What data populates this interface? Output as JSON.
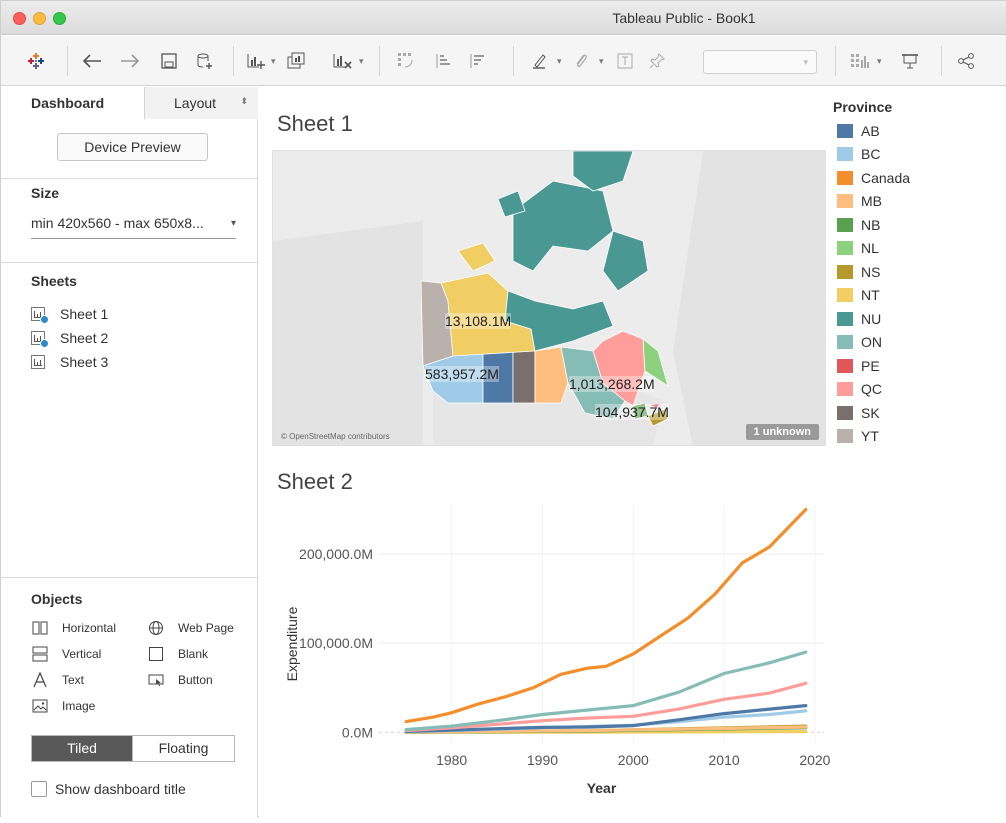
{
  "window": {
    "title": "Tableau Public - Book1"
  },
  "sidebar": {
    "tabs": [
      {
        "label": "Dashboard"
      },
      {
        "label": "Layout"
      }
    ],
    "device_preview": "Device Preview",
    "size": {
      "title": "Size",
      "value": "min 420x560 - max 650x8..."
    },
    "sheets": {
      "title": "Sheets",
      "items": [
        {
          "label": "Sheet 1"
        },
        {
          "label": "Sheet 2"
        },
        {
          "label": "Sheet 3"
        }
      ]
    },
    "objects": {
      "title": "Objects",
      "items": [
        {
          "label": "Horizontal",
          "icon": "horizontal-icon"
        },
        {
          "label": "Web Page",
          "icon": "globe-icon"
        },
        {
          "label": "Vertical",
          "icon": "vertical-icon"
        },
        {
          "label": "Blank",
          "icon": "blank-icon"
        },
        {
          "label": "Text",
          "icon": "text-icon"
        },
        {
          "label": "Button",
          "icon": "button-icon"
        },
        {
          "label": "Image",
          "icon": "image-icon"
        }
      ]
    },
    "layout_mode": {
      "tiled": "Tiled",
      "floating": "Floating"
    },
    "show_title": "Show dashboard title"
  },
  "dashboard": {
    "sheet1": {
      "title": "Sheet 1",
      "map_attribution": "© OpenStreetMap contributors",
      "unknown_badge": "1 unknown",
      "labels": [
        "13,108.1M",
        "583,957.2M",
        "1,013,268.2M",
        "104,937.7M"
      ]
    },
    "legend": {
      "title": "Province",
      "items": [
        {
          "label": "AB",
          "color": "#4e79a7"
        },
        {
          "label": "BC",
          "color": "#a0cbe8"
        },
        {
          "label": "Canada",
          "color": "#f28e2b"
        },
        {
          "label": "MB",
          "color": "#ffbe7d"
        },
        {
          "label": "NB",
          "color": "#59a14f"
        },
        {
          "label": "NL",
          "color": "#8cd17d"
        },
        {
          "label": "NS",
          "color": "#b6992d"
        },
        {
          "label": "NT",
          "color": "#f1ce63"
        },
        {
          "label": "NU",
          "color": "#499894"
        },
        {
          "label": "ON",
          "color": "#86bcb6"
        },
        {
          "label": "PE",
          "color": "#e15759"
        },
        {
          "label": "QC",
          "color": "#ff9d9a"
        },
        {
          "label": "SK",
          "color": "#79706e"
        },
        {
          "label": "YT",
          "color": "#bab0ac"
        }
      ]
    },
    "sheet2": {
      "title": "Sheet 2"
    }
  },
  "chart_data": {
    "type": "line",
    "xlabel": "Year",
    "ylabel": "Expenditure",
    "xlim": [
      1972,
      2021
    ],
    "ylim": [
      -12000,
      255000
    ],
    "xticks": [
      1980,
      1990,
      2000,
      2010,
      2020
    ],
    "yticks": [
      {
        "value": 0,
        "label": "0.0M"
      },
      {
        "value": 100000,
        "label": "100,000.0M"
      },
      {
        "value": 200000,
        "label": "200,000.0M"
      }
    ],
    "grid": true,
    "series": [
      {
        "name": "Canada",
        "color": "#f28e2b",
        "x": [
          1975,
          1978,
          1980,
          1983,
          1986,
          1989,
          1992,
          1995,
          1997,
          2000,
          2003,
          2006,
          2009,
          2012,
          2015,
          2019
        ],
        "y": [
          12000,
          17000,
          22000,
          32000,
          40000,
          50000,
          65000,
          72000,
          74000,
          88000,
          108000,
          128000,
          155000,
          190000,
          208000,
          250000
        ]
      },
      {
        "name": "ON",
        "color": "#86bcb6",
        "x": [
          1975,
          1980,
          1985,
          1990,
          1995,
          2000,
          2005,
          2010,
          2015,
          2019
        ],
        "y": [
          3000,
          7000,
          13000,
          20000,
          25000,
          30000,
          45000,
          66000,
          78000,
          90000
        ]
      },
      {
        "name": "QC",
        "color": "#ff9d9a",
        "x": [
          1975,
          1980,
          1985,
          1990,
          1995,
          2000,
          2005,
          2010,
          2015,
          2019
        ],
        "y": [
          2000,
          5000,
          9000,
          13000,
          16000,
          18000,
          26000,
          37000,
          44000,
          55000
        ]
      },
      {
        "name": "AB",
        "color": "#4e79a7",
        "x": [
          1975,
          1980,
          1985,
          1990,
          1995,
          2000,
          2005,
          2010,
          2015,
          2019
        ],
        "y": [
          1000,
          2500,
          4000,
          5500,
          6000,
          7500,
          14000,
          21000,
          26000,
          30000
        ]
      },
      {
        "name": "BC",
        "color": "#a0cbe8",
        "x": [
          1975,
          1980,
          1985,
          1990,
          1995,
          2000,
          2005,
          2010,
          2015,
          2019
        ],
        "y": [
          800,
          2000,
          3500,
          5000,
          6500,
          8000,
          12000,
          17000,
          20000,
          24000
        ]
      },
      {
        "name": "MB",
        "color": "#ffbe7d",
        "x": [
          1975,
          1985,
          1995,
          2005,
          2019
        ],
        "y": [
          300,
          1000,
          2000,
          3500,
          6000
        ]
      },
      {
        "name": "NB",
        "color": "#59a14f",
        "x": [
          1975,
          1985,
          1995,
          2005,
          2019
        ],
        "y": [
          200,
          600,
          1500,
          3000,
          5000
        ]
      },
      {
        "name": "NS",
        "color": "#b6992d",
        "x": [
          1975,
          1985,
          1995,
          2005,
          2019
        ],
        "y": [
          250,
          900,
          1800,
          3800,
          7000
        ]
      },
      {
        "name": "NT",
        "color": "#f1ce63",
        "x": [
          1975,
          1985,
          1995,
          2005,
          2019
        ],
        "y": [
          50,
          100,
          200,
          400,
          800
        ]
      }
    ]
  }
}
